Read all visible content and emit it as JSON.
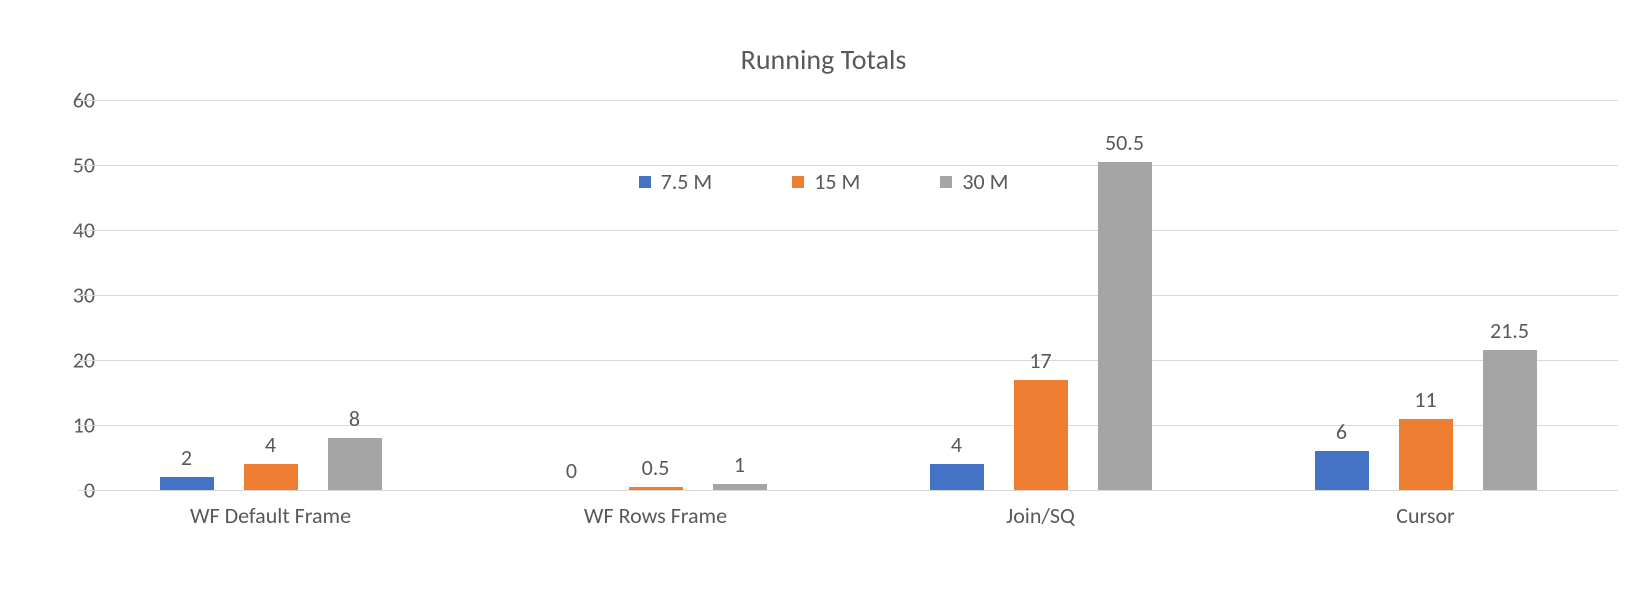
{
  "chart_data": {
    "type": "bar",
    "title": "Running Totals",
    "categories": [
      "WF Default Frame",
      "WF Rows Frame",
      "Join/SQ",
      "Cursor"
    ],
    "series": [
      {
        "name": "7.5 M",
        "color": "#4472C4",
        "values": [
          2,
          0,
          4,
          6
        ]
      },
      {
        "name": "15 M",
        "color": "#ED7D31",
        "values": [
          4,
          0.5,
          17,
          11
        ]
      },
      {
        "name": "30 M",
        "color": "#A5A5A5",
        "values": [
          8,
          1,
          50.5,
          21.5
        ]
      }
    ],
    "yticks": [
      0,
      10,
      20,
      30,
      40,
      50,
      60
    ],
    "ylim": [
      0,
      60
    ],
    "xlabel": "",
    "ylabel": "",
    "legend_position": "top-center"
  }
}
